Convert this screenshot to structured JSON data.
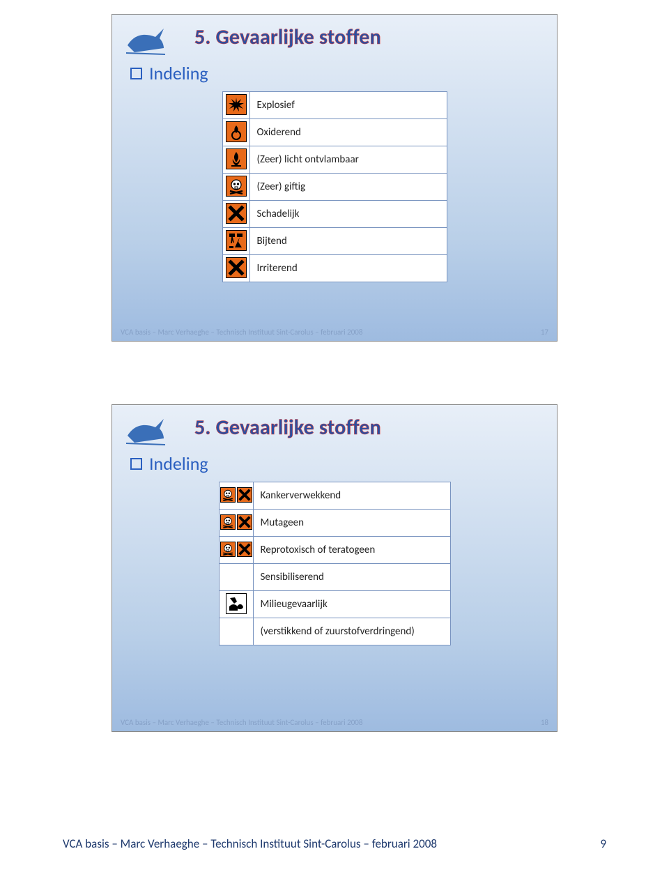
{
  "slide1": {
    "title": "5. Gevaarlijke stoffen",
    "section": "Indeling",
    "rows": [
      {
        "label": "Explosief"
      },
      {
        "label": "Oxiderend"
      },
      {
        "label": "(Zeer) licht ontvlambaar"
      },
      {
        "label": "(Zeer) giftig"
      },
      {
        "label": "Schadelijk"
      },
      {
        "label": "Bijtend"
      },
      {
        "label": "Irriterend"
      }
    ],
    "footer": "VCA basis – Marc Verhaeghe – Technisch Instituut Sint-Carolus – februari 2008",
    "page": "17"
  },
  "slide2": {
    "title": "5. Gevaarlijke stoffen",
    "section": "Indeling",
    "rows": [
      {
        "label": "Kankerverwekkend"
      },
      {
        "label": "Mutageen"
      },
      {
        "label": "Reprotoxisch of teratogeen"
      },
      {
        "label": "Sensibiliserend"
      },
      {
        "label": "Milieugevaarlijk"
      },
      {
        "label": "(verstikkend of zuurstofverdringend)"
      }
    ],
    "footer": "VCA basis – Marc Verhaeghe – Technisch Instituut Sint-Carolus – februari 2008",
    "page": "18"
  },
  "pagefooter": {
    "text": "VCA basis – Marc Verhaeghe – Technisch Instituut Sint-Carolus – februari 2008",
    "num": "9"
  }
}
